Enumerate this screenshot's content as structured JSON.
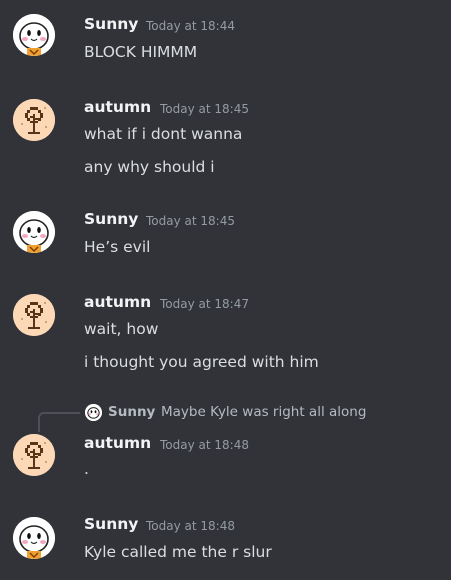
{
  "users": {
    "sunny": {
      "name": "Sunny",
      "avatar": "white-face-avatar"
    },
    "autumn": {
      "name": "autumn",
      "avatar": "pixel-tree-avatar"
    }
  },
  "messages": [
    {
      "author": "Sunny",
      "time": "Today at 18:44",
      "lines": [
        "BLOCK HIMMM"
      ]
    },
    {
      "author": "autumn",
      "time": "Today at 18:45",
      "lines": [
        "what if i dont wanna",
        "any why should i"
      ]
    },
    {
      "author": "Sunny",
      "time": "Today at 18:45",
      "lines": [
        "He’s evil"
      ]
    },
    {
      "author": "autumn",
      "time": "Today at 18:47",
      "lines": [
        "wait, how",
        "i thought you agreed with him"
      ]
    },
    {
      "author": "autumn",
      "time": "Today at 18:48",
      "lines": [
        "."
      ],
      "reply": {
        "author": "Sunny",
        "text": "Maybe Kyle was right all along"
      }
    },
    {
      "author": "Sunny",
      "time": "Today at 18:48",
      "lines": [
        "Kyle called me the r slur"
      ]
    }
  ],
  "colors": {
    "background": "#313338",
    "text": "#dbdee1",
    "muted": "#949ba4",
    "name": "#f2f3f5"
  }
}
